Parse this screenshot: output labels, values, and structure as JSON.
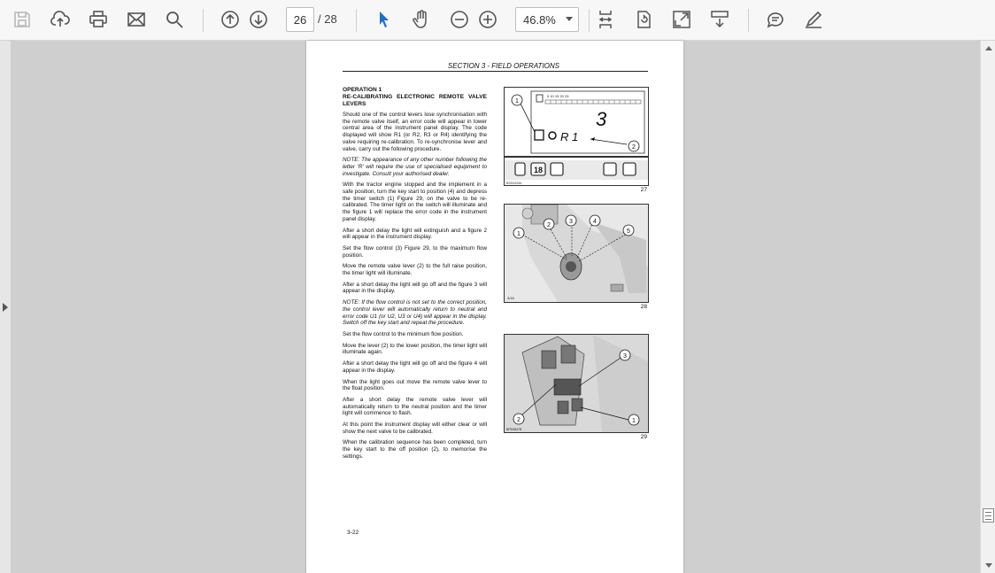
{
  "toolbar": {
    "page_current": "26",
    "page_total": "/ 28",
    "zoom": "46.8%"
  },
  "page": {
    "section_header": "SECTION 3  - FIELD OPERATIONS",
    "heading": "OPERATION 1\nRE-CALIBRATING ELECTRONIC REMOTE VALVE LEVERS",
    "paragraphs": [
      "Should one of the control levers lose synchronisation with the remote valve itself, an error code will appear in lower central area of the instrument panel display. The code displayed will show R1 (or R2, R3 or R4) identifying the valve requiring re-calibration. To re-synchronise lever and valve, carry out the following procedure.",
      "NOTE: The appearance of any other number following the letter 'R' will require the use of specialised equipment to investigate. Consult your authorised dealer.",
      "With the tractor engine stopped and the implement in a safe position, turn the key start to position (4) and depress the timer switch (1) Figure 29, on the valve to be re-calibrated. The timer light on the switch will illuminate and the figure 1 will replace the error code in the instrument panel display.",
      "After a short delay the light will extinguish and a figure 2 will appear in the instrument display.",
      "Set the flow control (3) Figure 29, to the maximum flow position.",
      "Move the remote valve lever (2) to the full raise position, the timer light will illuminate.",
      "After a short delay the light will go off and the figure 3 will appear in the display.",
      "NOTE: If the flow control is not set to the correct position, the control lever will automatically return to neutral and error code U1 (or U2, U3 or U4) will appear in the display. Switch off the key start and repeat the procedure.",
      "Set the flow control to the minimum flow position.",
      "Move the lever (2) to the lower position, the timer light will illuminate again.",
      "After a short delay the light will go off and the figure 4 will appear in the display.",
      "When the light goes out move the remote valve lever to the float position.",
      "After a short delay the remote valve lever will automatically return to the neutral position and the timer light will commence to flash.",
      "At this point the instrument display will either clear or will show the next valve to be calibrated.",
      "When the calibration sequence has been completed, turn the key start to the off position (2), to memorise the settings."
    ],
    "page_number": "3-22",
    "figures": [
      {
        "number": "27",
        "display_value": "3",
        "code": "R 1",
        "scale": "0    10        15        20        25",
        "ref": "BSD0443A"
      },
      {
        "number": "28",
        "ref": "3/18"
      },
      {
        "number": "29",
        "ref": "BPD0847B"
      }
    ]
  },
  "icons": [
    "save-icon",
    "upload-icon",
    "print-icon",
    "mail-icon",
    "search-icon",
    "arrow-up-icon",
    "arrow-down-icon",
    "select-cursor-icon",
    "hand-icon",
    "zoom-out-icon",
    "zoom-in-icon",
    "fit-page-icon",
    "rotate-icon",
    "fullscreen-icon",
    "scroll-mode-icon",
    "comment-icon",
    "sign-icon"
  ]
}
